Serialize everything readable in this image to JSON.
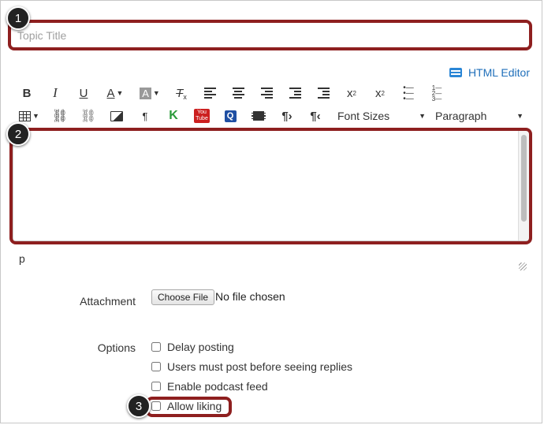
{
  "topic": {
    "title_placeholder": "Topic Title",
    "title_value": ""
  },
  "editor": {
    "html_editor_label": "HTML Editor",
    "toolbar_row1": [
      "bold",
      "italic",
      "underline",
      "text-color",
      "background-color",
      "clear-formatting",
      "align-left",
      "align-center",
      "align-right",
      "outdent",
      "indent",
      "superscript",
      "subscript",
      "bullet-list",
      "numbered-list"
    ],
    "toolbar_row2": [
      "table",
      "link",
      "unlink",
      "image",
      "paragraph-mark",
      "kaltura",
      "youtube",
      "quizlet",
      "media",
      "ltr",
      "rtl"
    ],
    "font_sizes_label": "Font Sizes",
    "paragraph_label": "Paragraph",
    "content": "",
    "status_path": "p"
  },
  "attachment": {
    "label": "Attachment",
    "button_label": "Choose File",
    "status": "No file chosen"
  },
  "options": {
    "label": "Options",
    "items": [
      {
        "label": "Delay posting",
        "checked": false
      },
      {
        "label": "Users must post before seeing replies",
        "checked": false
      },
      {
        "label": "Enable podcast feed",
        "checked": false
      },
      {
        "label": "Allow liking",
        "checked": false
      }
    ]
  },
  "callouts": [
    "1",
    "2",
    "3"
  ],
  "colors": {
    "callout": "#8e1f1f",
    "link": "#1f6fba",
    "badge": "#222222"
  }
}
